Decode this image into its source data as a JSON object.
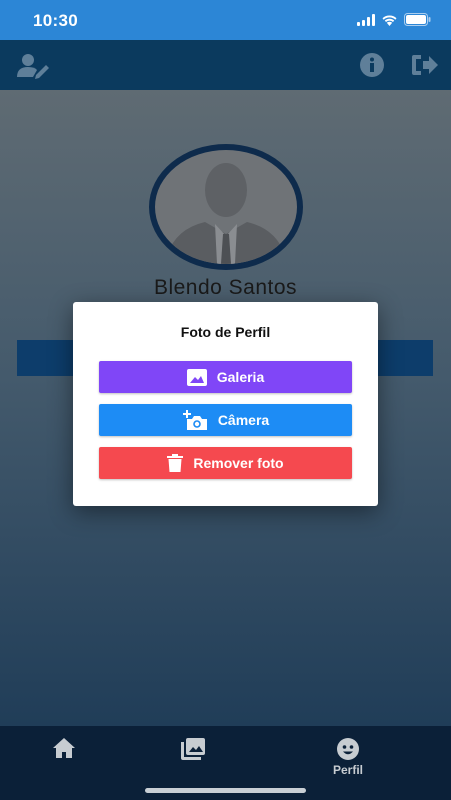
{
  "status_bar": {
    "time": "10:30"
  },
  "app_bar": {
    "left_icon": "user-edit-icon",
    "right_icons": [
      "info-icon",
      "logout-icon"
    ]
  },
  "profile": {
    "name": "Blendo Santos",
    "avatar_icon": "user-silhouette-icon"
  },
  "dialog": {
    "title": "Foto de Perfil",
    "buttons": [
      {
        "label": "Galeria",
        "icon": "image-icon",
        "color": "#8046f7"
      },
      {
        "label": "Câmera",
        "icon": "camera-add-icon",
        "color": "#1d8cf5"
      },
      {
        "label": "Remover foto",
        "icon": "trash-icon",
        "color": "#f5494f"
      }
    ]
  },
  "bottom_nav": {
    "items": [
      {
        "icon": "home-icon",
        "label": ""
      },
      {
        "icon": "photos-icon",
        "label": ""
      },
      {
        "icon": "profile-face-icon",
        "label": "Perfil",
        "active": true
      }
    ]
  },
  "colors": {
    "status_bar": "#2c86d6",
    "app_bar": "#0b3a5e",
    "nav_bar": "#0b2038"
  }
}
